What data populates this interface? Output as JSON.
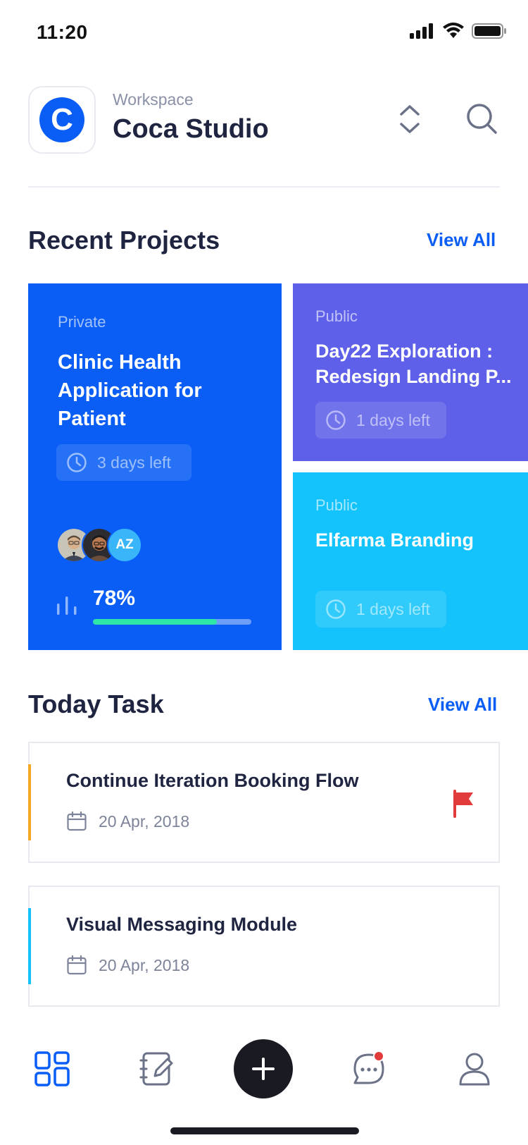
{
  "status_bar": {
    "time": "11:20",
    "icons": [
      "signal-icon",
      "wifi-icon",
      "battery-icon"
    ]
  },
  "workspace": {
    "logo_letter": "C",
    "kicker": "Workspace",
    "name": "Coca Studio",
    "icons": [
      "chevron-up-down-icon",
      "search-icon"
    ]
  },
  "colors": {
    "accent": "#0a5ef5",
    "purple": "#5e60e9",
    "cyan": "#14c3fb",
    "progress": "#2ee6a6",
    "task_accent_1": "#f5a623",
    "task_accent_2": "#14c3fb",
    "flag": "#e23b3b",
    "notification": "#e23b3b"
  },
  "recent_projects": {
    "title": "Recent Projects",
    "view_all": "View All",
    "projects": [
      {
        "visibility": "Private",
        "title": "Clinic Health Application for Patient",
        "deadline": "3 days left",
        "members": [
          "avatar-man-glasses",
          "avatar-man-smiling",
          "AZ"
        ],
        "progress_label": "78%",
        "progress": 0.78
      },
      {
        "visibility": "Public",
        "title": "Day22 Exploration : Redesign Landing P...",
        "deadline": "1 days left"
      },
      {
        "visibility": "Public",
        "title": "Elfarma Branding",
        "deadline": "1 days left"
      }
    ]
  },
  "today_task": {
    "title": "Today Task",
    "view_all": "View All",
    "tasks": [
      {
        "title": "Continue Iteration Booking Flow",
        "date": "20 Apr, 2018",
        "flagged": true
      },
      {
        "title": "Visual Messaging Module",
        "date": "20 Apr, 2018",
        "flagged": false
      }
    ]
  },
  "tab_bar": {
    "items": [
      "dashboard-icon",
      "notes-icon",
      "add-icon",
      "chat-icon",
      "profile-icon"
    ],
    "active": "dashboard-icon",
    "chat_has_notification": true
  }
}
